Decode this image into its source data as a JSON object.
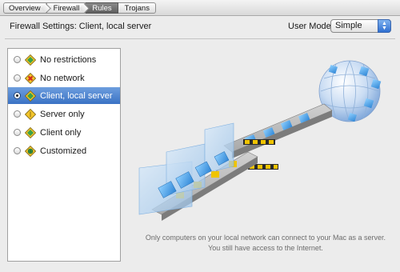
{
  "breadcrumb": {
    "items": [
      {
        "label": "Overview"
      },
      {
        "label": "Firewall"
      },
      {
        "label": "Rules"
      },
      {
        "label": "Trojans"
      }
    ],
    "active_index": 2
  },
  "header": {
    "title": "Firewall Settings:  Client, local server",
    "user_mode_label": "User Mode:",
    "user_mode_value": "Simple"
  },
  "rules_list": {
    "items": [
      {
        "label": "No restrictions",
        "icon": "diamond-green-icon",
        "selected": false
      },
      {
        "label": "No network",
        "icon": "diamond-red-x-icon",
        "selected": false
      },
      {
        "label": "Client, local server",
        "icon": "diamond-green-icon",
        "selected": true
      },
      {
        "label": "Server only",
        "icon": "diamond-yellow-icon",
        "selected": false
      },
      {
        "label": "Client only",
        "icon": "diamond-green-icon",
        "selected": false
      },
      {
        "label": "Customized",
        "icon": "diamond-customized-icon",
        "selected": false
      }
    ]
  },
  "illustration": {
    "name": "network-illustration",
    "description": "Only computers on your local network can connect to your Mac as a server. You still have access to the Internet."
  },
  "colors": {
    "selection": "#3a72c4",
    "globe": "#8fb6e6",
    "block_blue": "#3a9ae0",
    "beam": "#9a9a9a",
    "barrier": "#f0c400"
  }
}
